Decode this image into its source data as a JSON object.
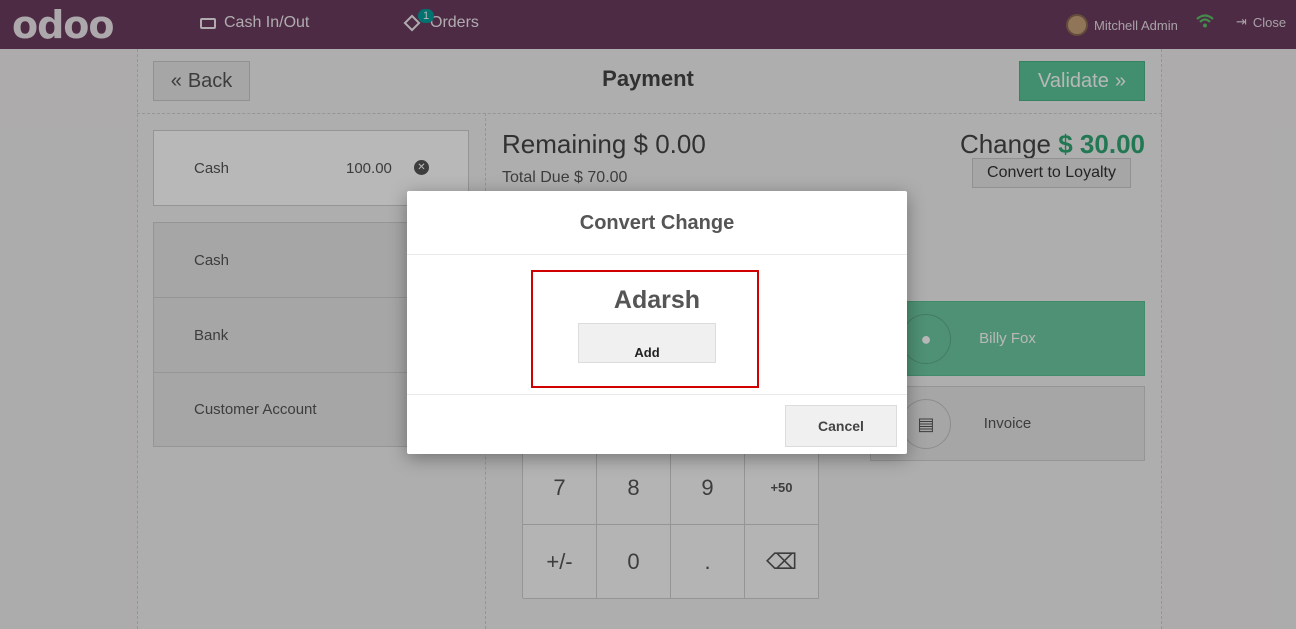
{
  "navbar": {
    "logo": "odoo",
    "cash_in_out": "Cash In/Out",
    "orders": "Orders",
    "orders_badge": "1",
    "user": "Mitchell Admin",
    "close": "Close"
  },
  "header": {
    "back": "Back",
    "title": "Payment",
    "validate": "Validate"
  },
  "payment_lines": [
    {
      "method": "Cash",
      "amount": "100.00"
    }
  ],
  "payment_methods": [
    "Cash",
    "Bank",
    "Customer Account"
  ],
  "summary": {
    "remaining_label": "Remaining",
    "remaining_value": "$ 0.00",
    "total_due_label": "Total Due",
    "total_due_value": "$ 70.00",
    "change_label": "Change",
    "change_value": "$ 30.00",
    "convert_button": "Convert to Loyalty"
  },
  "customer_button": "Billy Fox",
  "invoice_button": "Invoice",
  "numpad": {
    "keys": [
      "7",
      "8",
      "9",
      "+50",
      "+/-",
      "0",
      ".",
      "⌫"
    ]
  },
  "modal": {
    "title": "Convert Change",
    "customer_name": "Adarsh",
    "add_button": "Add",
    "cancel_button": "Cancel"
  },
  "colors": {
    "navbar": "#6b3c5f",
    "validate": "#5ac69a",
    "change_value": "#2fa774",
    "highlight": "#d00000"
  }
}
